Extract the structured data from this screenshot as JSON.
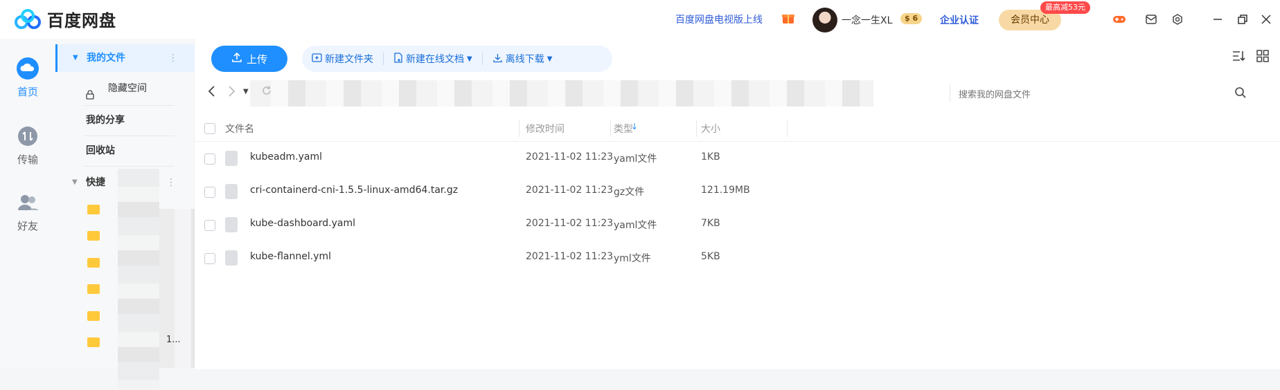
{
  "app": {
    "logo_text": "百度网盘"
  },
  "header": {
    "promo_link": "百度网盘电视版上线",
    "username": "一念一生XL",
    "vip_badge": "$ 6",
    "enterprise": "企业认证",
    "member_button": "会员中心",
    "member_tag": "最高减53元"
  },
  "leftnav": {
    "items": [
      {
        "label": "首页",
        "icon": "cloud-icon"
      },
      {
        "label": "传输",
        "icon": "transfer-icon"
      },
      {
        "label": "好友",
        "icon": "friends-icon"
      }
    ]
  },
  "sidebar": {
    "my_files": "我的文件",
    "hidden_space": "隐藏空间",
    "my_share": "我的分享",
    "recycle": "回收站",
    "quick_access": "快捷",
    "truncated_item": "1..."
  },
  "toolbar": {
    "upload": "上传",
    "new_folder": "新建文件夹",
    "new_doc": "新建在线文档",
    "offline_download": "离线下载"
  },
  "search": {
    "placeholder": "搜索我的网盘文件"
  },
  "table": {
    "headers": {
      "name": "文件名",
      "modified": "修改时间",
      "type": "类型",
      "size": "大小"
    },
    "rows": [
      {
        "name": "kubeadm.yaml",
        "modified": "2021-11-02 11:23",
        "type": "yaml文件",
        "size": "1KB"
      },
      {
        "name": "cri-containerd-cni-1.5.5-linux-amd64.tar.gz",
        "modified": "2021-11-02 11:23",
        "type": "gz文件",
        "size": "121.19MB"
      },
      {
        "name": "kube-dashboard.yaml",
        "modified": "2021-11-02 11:23",
        "type": "yaml文件",
        "size": "7KB"
      },
      {
        "name": "kube-flannel.yml",
        "modified": "2021-11-02 11:23",
        "type": "yml文件",
        "size": "5KB"
      }
    ]
  },
  "colors": {
    "accent": "#1f8fff",
    "link": "#2e5bd8",
    "member_bg": "#f8d9a5",
    "tag_red": "#ff4a4a"
  }
}
